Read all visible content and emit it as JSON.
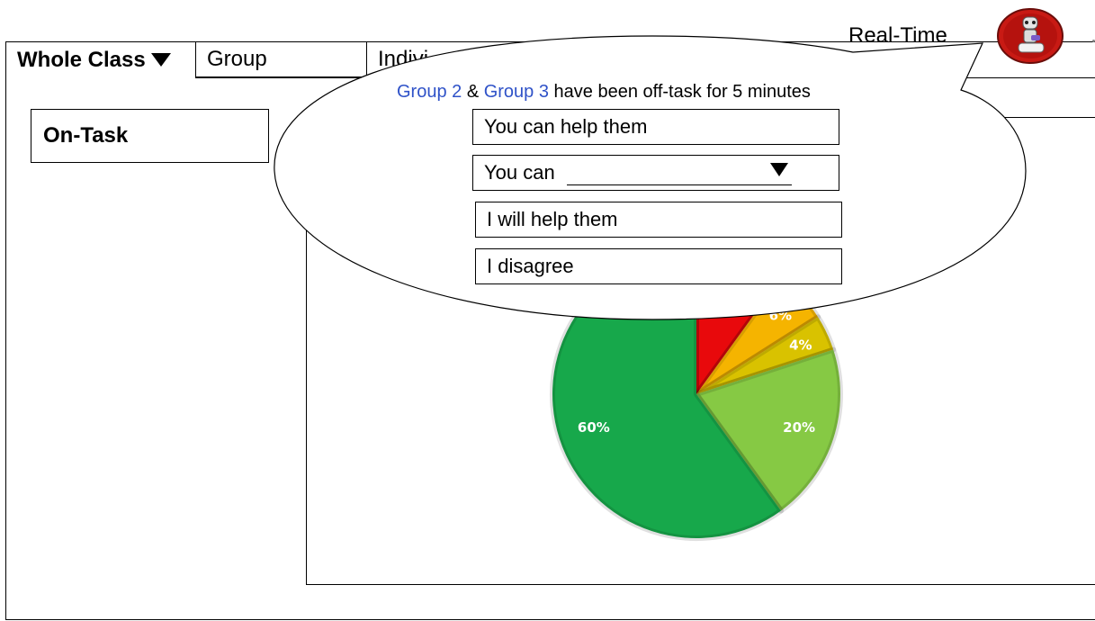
{
  "tabs": {
    "whole_class": "Whole Class",
    "group": "Group",
    "individual": "Indivi"
  },
  "left_panel": {
    "title": "On-Task"
  },
  "notification": {
    "label": "Real-Time",
    "group_a": "Group 2",
    "amp": " & ",
    "group_b": "Group 3",
    "message": " have been off-task for 5 minutes",
    "options": {
      "help": "You can help them",
      "you_can": "You can",
      "will_help": "I will help them",
      "disagree": "I disagree"
    }
  },
  "colors": {
    "group_link": "#2f52c8",
    "pie_red": "#e8090c",
    "pie_orange": "#f5b400",
    "pie_yellow": "#d9c200",
    "pie_light_green": "#86c944",
    "pie_dark_green": "#17a84b"
  },
  "icons": {
    "avatar": "robot-avatar-icon",
    "dropdown": "caret-down-icon"
  },
  "chart_data": {
    "type": "pie",
    "categories": [
      "",
      "",
      "",
      "",
      ""
    ],
    "values": [
      10,
      6,
      4,
      20,
      60
    ],
    "labels": [
      "",
      "6%",
      "4%",
      "20%",
      "60%"
    ],
    "colors": [
      "#e8090c",
      "#f5b400",
      "#d9c200",
      "#86c944",
      "#17a84b"
    ]
  }
}
